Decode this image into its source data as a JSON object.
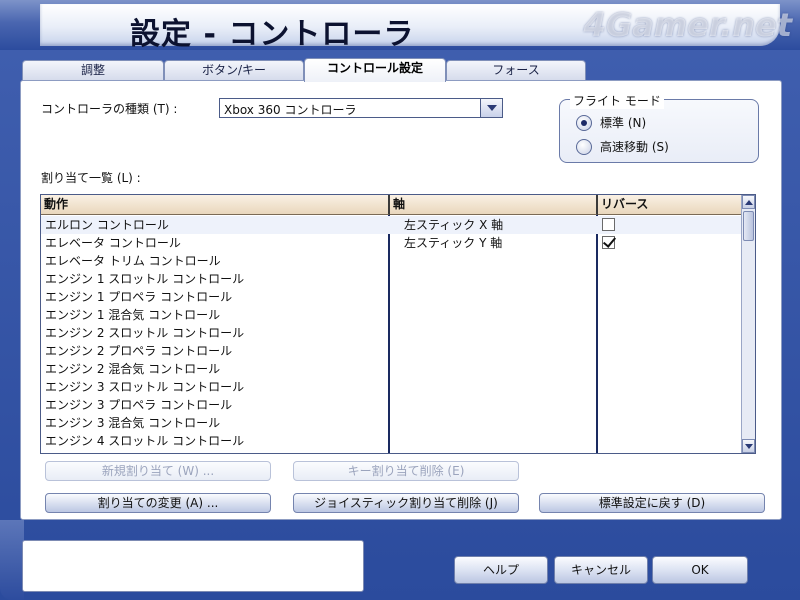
{
  "window": {
    "title": "設定 - コントローラ",
    "watermark": "4Gamer.net"
  },
  "tabs": [
    {
      "label": "調整",
      "active": false
    },
    {
      "label": "ボタン/キー",
      "active": false
    },
    {
      "label": "コントロール設定",
      "active": true
    },
    {
      "label": "フォース",
      "active": false
    }
  ],
  "controller_type": {
    "label": "コントローラの種類 (T) :",
    "value": "Xbox 360 コントローラ"
  },
  "flight_mode": {
    "title": "フライト モード",
    "options": [
      {
        "label": "標準 (N)",
        "selected": true
      },
      {
        "label": "高速移動 (S)",
        "selected": false
      }
    ]
  },
  "assignment_list": {
    "label": "割り当て一覧 (L) :",
    "columns": [
      "動作",
      "軸",
      "リバース"
    ],
    "rows": [
      {
        "action": "エルロン コントロール",
        "axis": "左スティック X 軸",
        "reverse": false,
        "has_checkbox": true
      },
      {
        "action": "エレベータ コントロール",
        "axis": "左スティック Y 軸",
        "reverse": true,
        "has_checkbox": true
      },
      {
        "action": "エレベータ トリム コントロール",
        "axis": "",
        "has_checkbox": false
      },
      {
        "action": "エンジン 1 スロットル コントロール",
        "axis": "",
        "has_checkbox": false
      },
      {
        "action": "エンジン 1 プロペラ コントロール",
        "axis": "",
        "has_checkbox": false
      },
      {
        "action": "エンジン 1 混合気 コントロール",
        "axis": "",
        "has_checkbox": false
      },
      {
        "action": "エンジン 2 スロットル コントロール",
        "axis": "",
        "has_checkbox": false
      },
      {
        "action": "エンジン 2 プロペラ コントロール",
        "axis": "",
        "has_checkbox": false
      },
      {
        "action": "エンジン 2 混合気 コントロール",
        "axis": "",
        "has_checkbox": false
      },
      {
        "action": "エンジン 3 スロットル コントロール",
        "axis": "",
        "has_checkbox": false
      },
      {
        "action": "エンジン 3 プロペラ コントロール",
        "axis": "",
        "has_checkbox": false
      },
      {
        "action": "エンジン 3 混合気 コントロール",
        "axis": "",
        "has_checkbox": false
      },
      {
        "action": "エンジン 4 スロットル コントロール",
        "axis": "",
        "has_checkbox": false
      }
    ]
  },
  "buttons": {
    "new_assignment": "新規割り当て (W) ...",
    "delete_key": "キー割り当て削除 (E)",
    "change_assignment": "割り当ての変更 (A) ...",
    "delete_joystick": "ジョイスティック割り当て削除 (J)",
    "reset_defaults": "標準設定に戻す (D)"
  },
  "footer": {
    "help": "ヘルプ",
    "cancel": "キャンセル",
    "ok": "OK"
  }
}
